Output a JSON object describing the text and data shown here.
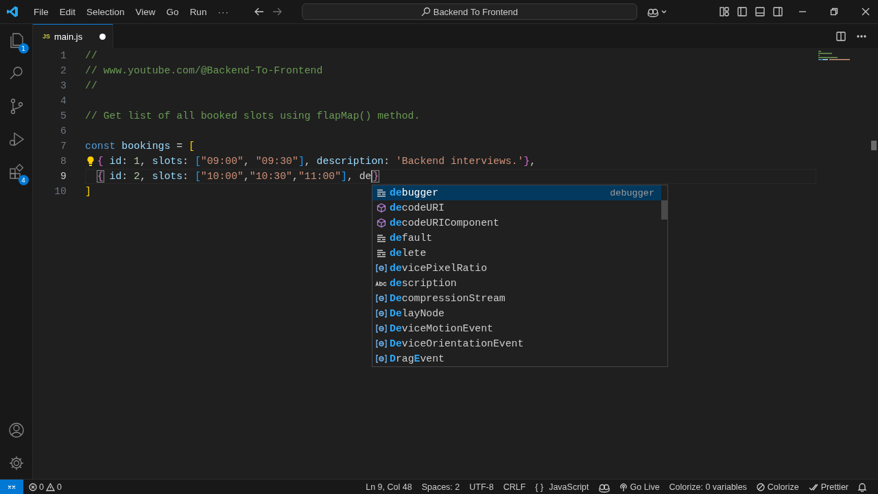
{
  "title_bar": {
    "menus": [
      "File",
      "Edit",
      "Selection",
      "View",
      "Go",
      "Run"
    ],
    "more": "···",
    "command_center": "Backend To Frontend"
  },
  "activity_bar": {
    "items": [
      {
        "kind": "explorer",
        "badge": "1"
      },
      {
        "kind": "search"
      },
      {
        "kind": "source-control"
      },
      {
        "kind": "run-debug"
      },
      {
        "kind": "extensions",
        "badge": "4"
      }
    ],
    "bottom": [
      {
        "kind": "account"
      },
      {
        "kind": "settings"
      }
    ]
  },
  "tabs": [
    {
      "label": "main.js",
      "icon": "JS",
      "selected": true,
      "modified": true
    }
  ],
  "editor": {
    "lines": [
      {
        "number": "1",
        "tokens": [
          {
            "text": "//",
            "kind": "comment"
          }
        ]
      },
      {
        "number": "2",
        "tokens": [
          {
            "text": "// www.youtube.com/@Backend-To-Frontend",
            "kind": "comment"
          }
        ]
      },
      {
        "number": "3",
        "tokens": [
          {
            "text": "//",
            "kind": "comment"
          }
        ]
      },
      {
        "number": "4"
      },
      {
        "number": "5",
        "tokens": [
          {
            "text": "// Get list of all booked slots using flapMap() method.",
            "kind": "comment"
          }
        ]
      },
      {
        "number": "6"
      },
      {
        "number": "7",
        "tokens": [
          {
            "text": "const",
            "kind": "keyword"
          },
          {
            "text": "bookings",
            "kind": "variable",
            "space_before": true
          },
          {
            "text": " = ",
            "kind": "plain"
          },
          {
            "text": "[",
            "kind": "bracket1"
          }
        ]
      },
      {
        "number": "8",
        "lightbulb": true,
        "indented": true,
        "tokens": [
          {
            "text": "{",
            "kind": "bracket2"
          },
          {
            "text": "id",
            "kind": "property",
            "space_before": true
          },
          {
            "text": ": ",
            "kind": "plain"
          },
          {
            "text": "1",
            "kind": "number"
          },
          {
            "text": ", ",
            "kind": "plain"
          },
          {
            "text": "slots",
            "kind": "property"
          },
          {
            "text": ": ",
            "kind": "plain"
          },
          {
            "text": "[",
            "kind": "bracket3"
          },
          {
            "text": "\"09:00\"",
            "kind": "string"
          },
          {
            "text": ", ",
            "kind": "plain"
          },
          {
            "text": "\"09:30\"",
            "kind": "string"
          },
          {
            "text": "]",
            "kind": "bracket3"
          },
          {
            "text": ", ",
            "kind": "plain"
          },
          {
            "text": "description",
            "kind": "property"
          },
          {
            "text": ": ",
            "kind": "plain"
          },
          {
            "text": "'Backend interviews.'",
            "kind": "string"
          },
          {
            "text": "}",
            "kind": "bracket2"
          },
          {
            "text": ",",
            "kind": "plain"
          }
        ]
      },
      {
        "number": "9",
        "active": true,
        "indented": true,
        "tokens": [
          {
            "text": "{",
            "kind": "bracket2",
            "matched": true
          },
          {
            "text": "id",
            "kind": "property",
            "space_before": true
          },
          {
            "text": ": ",
            "kind": "plain"
          },
          {
            "text": "2",
            "kind": "number"
          },
          {
            "text": ", ",
            "kind": "plain"
          },
          {
            "text": "slots",
            "kind": "property"
          },
          {
            "text": ": ",
            "kind": "plain"
          },
          {
            "text": "[",
            "kind": "bracket3"
          },
          {
            "text": "\"10:00\"",
            "kind": "string"
          },
          {
            "text": ",",
            "kind": "plain"
          },
          {
            "text": "\"10:30\"",
            "kind": "string"
          },
          {
            "text": ",",
            "kind": "plain"
          },
          {
            "text": "\"11:00\"",
            "kind": "string"
          },
          {
            "text": "]",
            "kind": "bracket3"
          },
          {
            "text": ", ",
            "kind": "plain"
          },
          {
            "text": "de",
            "kind": "plain",
            "caret": true
          },
          {
            "text": "}",
            "kind": "bracket2",
            "matched": true
          }
        ]
      },
      {
        "number": "10",
        "tokens": [
          {
            "text": "]",
            "kind": "bracket1"
          }
        ]
      }
    ],
    "suggestions": [
      {
        "kind": "keyword",
        "selected": true,
        "detail": "debugger",
        "parts": [
          {
            "text": "de",
            "match": true
          },
          {
            "text": "bugger",
            "match": false
          }
        ]
      },
      {
        "kind": "module",
        "selected": false,
        "parts": [
          {
            "text": "de",
            "match": true
          },
          {
            "text": "codeURI",
            "match": false
          }
        ]
      },
      {
        "kind": "module",
        "selected": false,
        "parts": [
          {
            "text": "de",
            "match": true
          },
          {
            "text": "codeURIComponent",
            "match": false
          }
        ]
      },
      {
        "kind": "keyword",
        "selected": false,
        "parts": [
          {
            "text": "de",
            "match": true
          },
          {
            "text": "fault",
            "match": false
          }
        ]
      },
      {
        "kind": "keyword",
        "selected": false,
        "parts": [
          {
            "text": "de",
            "match": true
          },
          {
            "text": "lete",
            "match": false
          }
        ]
      },
      {
        "kind": "variable",
        "selected": false,
        "parts": [
          {
            "text": "de",
            "match": true
          },
          {
            "text": "vicePixelRatio",
            "match": false
          }
        ]
      },
      {
        "kind": "text",
        "selected": false,
        "parts": [
          {
            "text": "de",
            "match": true
          },
          {
            "text": "scription",
            "match": false
          }
        ]
      },
      {
        "kind": "variable",
        "selected": false,
        "parts": [
          {
            "text": "De",
            "match": true
          },
          {
            "text": "compressionStream",
            "match": false
          }
        ]
      },
      {
        "kind": "variable",
        "selected": false,
        "parts": [
          {
            "text": "De",
            "match": true
          },
          {
            "text": "layNode",
            "match": false
          }
        ]
      },
      {
        "kind": "variable",
        "selected": false,
        "parts": [
          {
            "text": "De",
            "match": true
          },
          {
            "text": "viceMotionEvent",
            "match": false
          }
        ]
      },
      {
        "kind": "variable",
        "selected": false,
        "parts": [
          {
            "text": "De",
            "match": true
          },
          {
            "text": "viceOrientationEvent",
            "match": false
          }
        ]
      },
      {
        "kind": "variable",
        "selected": false,
        "parts": [
          {
            "text": "D",
            "match": true
          },
          {
            "text": "rag",
            "match": false
          },
          {
            "text": "E",
            "match": true
          },
          {
            "text": "vent",
            "match": false
          }
        ]
      }
    ]
  },
  "status_bar": {
    "errors": "0",
    "warnings": "0",
    "items": [
      {
        "kind": "text",
        "text": "Ln 9, Col 48"
      },
      {
        "kind": "text",
        "text": "Spaces: 2"
      },
      {
        "kind": "text",
        "text": "UTF-8"
      },
      {
        "kind": "text",
        "text": "CRLF"
      },
      {
        "kind": "braces",
        "prefix": "{ }",
        "text": "JavaScript"
      },
      {
        "kind": "copilot"
      },
      {
        "kind": "golive",
        "text": "Go Live"
      },
      {
        "kind": "text",
        "text": "Colorize: 0 variables"
      },
      {
        "kind": "colorize",
        "text": "Colorize"
      },
      {
        "kind": "prettier",
        "text": "Prettier"
      },
      {
        "kind": "bell"
      }
    ]
  }
}
